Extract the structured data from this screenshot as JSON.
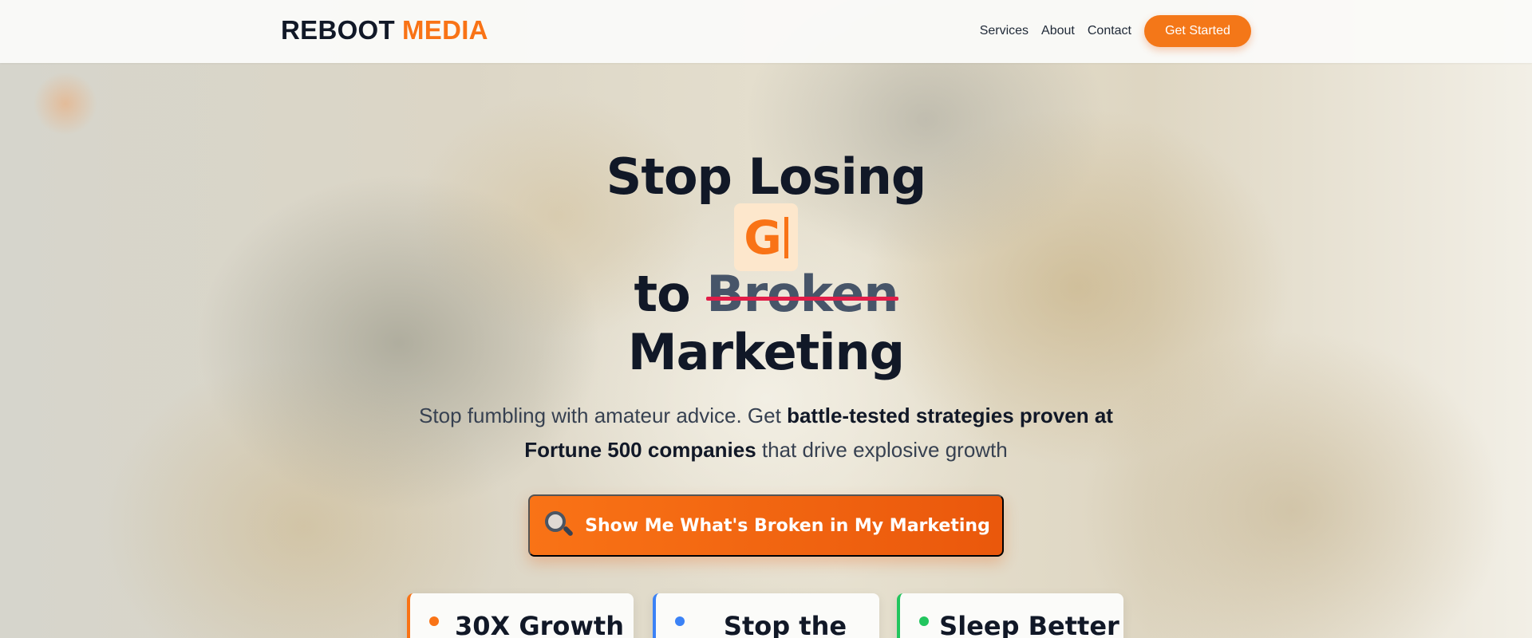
{
  "header": {
    "logo_part1": "REBOOT",
    "logo_part2": "MEDIA",
    "nav": [
      "Services",
      "About",
      "Contact"
    ],
    "cta_label": "Get Started"
  },
  "hero": {
    "line1": "Stop Losing",
    "typed_text": "G",
    "line3_prefix": "to",
    "line3_struck": "Broken",
    "line4": "Marketing",
    "sub_part1": "Stop fumbling with amateur advice. Get ",
    "sub_bold": "battle-tested strategies proven at Fortune 500 companies",
    "sub_part2": " that drive explosive growth",
    "cta_label": "Show Me What's Broken in My Marketing",
    "cta_icon": "magnifying-glass-icon"
  },
  "cards": [
    {
      "title": "30X Growth",
      "accent": "#f97316"
    },
    {
      "title": "Stop the",
      "accent": "#3b82f6"
    },
    {
      "title": "Sleep Better",
      "accent": "#22c55e"
    }
  ],
  "colors": {
    "brand": "#f97316",
    "text": "#111827",
    "strike": "#e11d48"
  }
}
